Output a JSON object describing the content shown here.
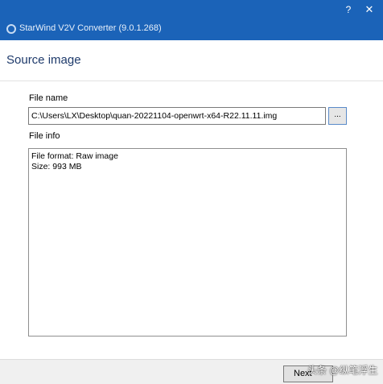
{
  "window": {
    "title": "StarWind V2V Converter (9.0.1.268)",
    "help_glyph": "?",
    "close_glyph": "✕",
    "colors": {
      "titlebar": "#1b63b8",
      "heading": "#1e3a6b"
    }
  },
  "page": {
    "heading": "Source image",
    "file_name_label": "File name",
    "file_name_value": "C:\\Users\\LX\\Desktop\\quan-20221104-openwrt-x64-R22.11.11.img",
    "browse_label": "...",
    "file_info_label": "File info",
    "file_info_lines": [
      "File format: Raw image",
      "Size: 993 MB"
    ]
  },
  "footer": {
    "next_label": "Next",
    "watermark": "头条 @纵笔浮生"
  }
}
